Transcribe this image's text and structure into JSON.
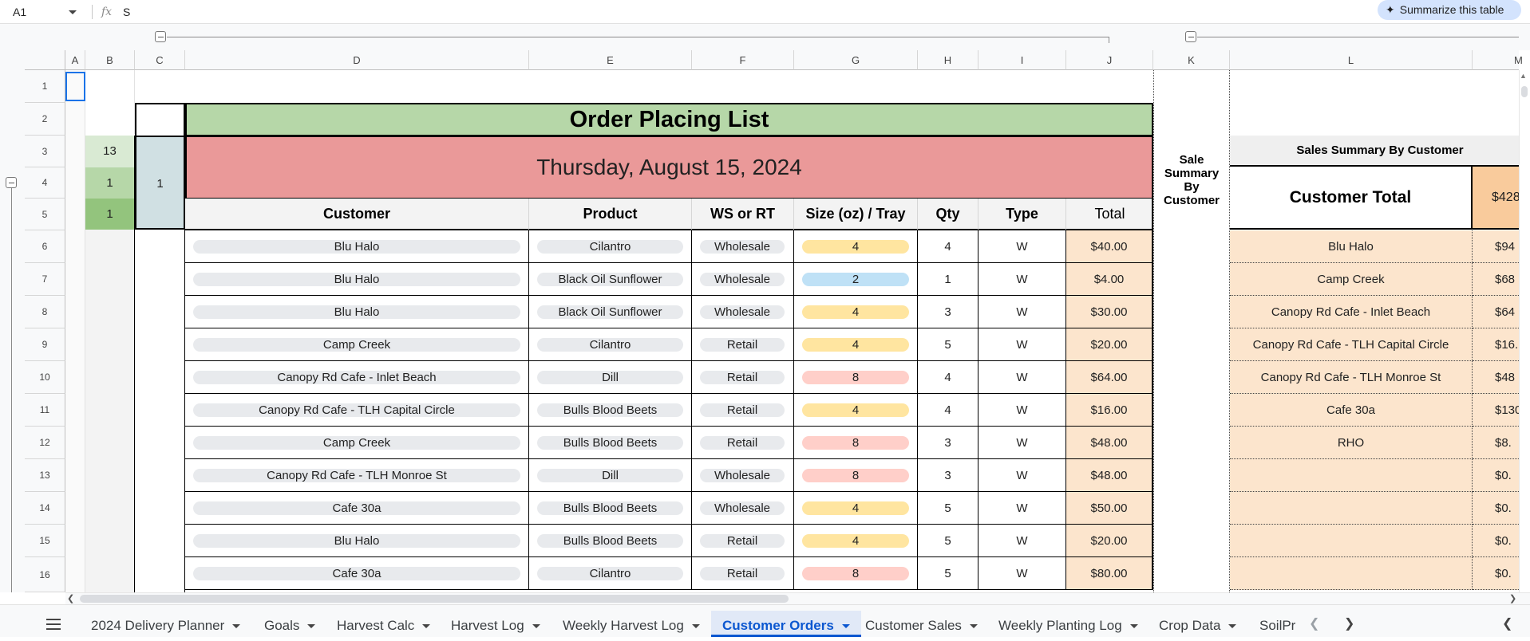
{
  "formula_bar": {
    "cell_ref": "A1",
    "fx": "fx",
    "value": "S",
    "summarize": "Summarize this table"
  },
  "columns": [
    "A",
    "B",
    "C",
    "D",
    "E",
    "F",
    "G",
    "H",
    "I",
    "J",
    "K",
    "L",
    "M"
  ],
  "rows": [
    "1",
    "2",
    "3",
    "4",
    "5",
    "6",
    "7",
    "8",
    "9",
    "10",
    "11",
    "12",
    "13",
    "14",
    "15",
    "16"
  ],
  "sheet": {
    "title": "Order Placing List",
    "date": "Thursday, August 15, 2024",
    "b3": "13",
    "b4": "1",
    "b5": "1",
    "c4": "1",
    "headers": {
      "customer": "Customer",
      "product": "Product",
      "ws_rt": "WS or RT",
      "size": "Size (oz) / Tray",
      "qty": "Qty",
      "type": "Type",
      "total": "Total"
    },
    "k_label": "Sale Summary By Customer",
    "summary_title": "Sales Summary By Customer",
    "summary_header": "Customer Total",
    "summary_header_value": "$428",
    "orders": [
      {
        "customer": "Blu Halo",
        "product": "Cilantro",
        "ws_rt": "Wholesale",
        "size": "4",
        "qty": "4",
        "type": "W",
        "total": "$40.00"
      },
      {
        "customer": "Blu Halo",
        "product": "Black Oil Sunflower",
        "ws_rt": "Wholesale",
        "size": "2",
        "qty": "1",
        "type": "W",
        "total": "$4.00"
      },
      {
        "customer": "Blu Halo",
        "product": "Black Oil Sunflower",
        "ws_rt": "Wholesale",
        "size": "4",
        "qty": "3",
        "type": "W",
        "total": "$30.00"
      },
      {
        "customer": "Camp Creek",
        "product": "Cilantro",
        "ws_rt": "Retail",
        "size": "4",
        "qty": "5",
        "type": "W",
        "total": "$20.00"
      },
      {
        "customer": "Canopy Rd Cafe - Inlet Beach",
        "product": "Dill",
        "ws_rt": "Retail",
        "size": "8",
        "qty": "4",
        "type": "W",
        "total": "$64.00"
      },
      {
        "customer": "Canopy Rd Cafe - TLH Capital Circle",
        "product": "Bulls Blood Beets",
        "ws_rt": "Retail",
        "size": "4",
        "qty": "4",
        "type": "W",
        "total": "$16.00"
      },
      {
        "customer": "Camp Creek",
        "product": "Bulls Blood Beets",
        "ws_rt": "Retail",
        "size": "8",
        "qty": "3",
        "type": "W",
        "total": "$48.00"
      },
      {
        "customer": "Canopy Rd Cafe - TLH Monroe St",
        "product": "Dill",
        "ws_rt": "Wholesale",
        "size": "8",
        "qty": "3",
        "type": "W",
        "total": "$48.00"
      },
      {
        "customer": "Cafe 30a",
        "product": "Bulls Blood Beets",
        "ws_rt": "Wholesale",
        "size": "4",
        "qty": "5",
        "type": "W",
        "total": "$50.00"
      },
      {
        "customer": "Blu Halo",
        "product": "Bulls Blood Beets",
        "ws_rt": "Retail",
        "size": "4",
        "qty": "5",
        "type": "W",
        "total": "$20.00"
      },
      {
        "customer": "Cafe 30a",
        "product": "Cilantro",
        "ws_rt": "Retail",
        "size": "8",
        "qty": "5",
        "type": "W",
        "total": "$80.00"
      }
    ],
    "summary": [
      {
        "customer": "Blu Halo",
        "total": "$94"
      },
      {
        "customer": "Camp Creek",
        "total": "$68"
      },
      {
        "customer": "Canopy Rd Cafe - Inlet Beach",
        "total": "$64"
      },
      {
        "customer": "Canopy Rd Cafe - TLH Capital Circle",
        "total": "$16."
      },
      {
        "customer": "Canopy Rd Cafe - TLH Monroe St",
        "total": "$48"
      },
      {
        "customer": "Cafe 30a",
        "total": "$130"
      },
      {
        "customer": "RHO",
        "total": "$8."
      },
      {
        "customer": "",
        "total": "$0."
      },
      {
        "customer": "",
        "total": "$0."
      },
      {
        "customer": "",
        "total": "$0."
      },
      {
        "customer": "",
        "total": "$0."
      }
    ]
  },
  "size_colors": {
    "2": "#bfe1f6",
    "4": "#ffe5a0",
    "8": "#ffcfc9"
  },
  "tabs": [
    {
      "label": "2024 Delivery Planner",
      "active": false
    },
    {
      "label": "Goals",
      "active": false
    },
    {
      "label": "Harvest Calc",
      "active": false
    },
    {
      "label": "Harvest Log",
      "active": false
    },
    {
      "label": "Weekly Harvest Log",
      "active": false
    },
    {
      "label": "Customer Orders",
      "active": true
    },
    {
      "label": "Customer Sales",
      "active": false
    },
    {
      "label": "Weekly Planting Log",
      "active": false
    },
    {
      "label": "Crop Data",
      "active": false
    },
    {
      "label": "SoilPr",
      "active": false
    }
  ]
}
